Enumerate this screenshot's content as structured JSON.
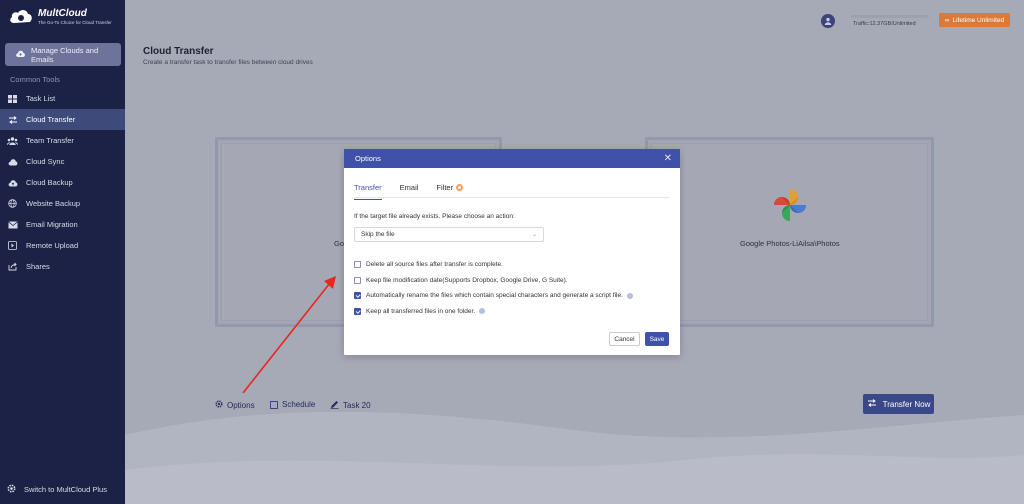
{
  "sidebar": {
    "logo_title": "MultCloud",
    "logo_subtitle": "The Go-To Choice for Cloud Transfer",
    "manage_label": "Manage Clouds and Emails",
    "common_tools_label": "Common Tools",
    "items": [
      {
        "label": "Task List",
        "icon": "task-list-icon"
      },
      {
        "label": "Cloud Transfer",
        "icon": "transfer-icon",
        "active": true
      },
      {
        "label": "Team Transfer",
        "icon": "team-icon"
      },
      {
        "label": "Cloud Sync",
        "icon": "sync-icon"
      },
      {
        "label": "Cloud Backup",
        "icon": "cloud-backup-icon"
      },
      {
        "label": "Website Backup",
        "icon": "globe-icon"
      },
      {
        "label": "Email Migration",
        "icon": "email-icon"
      },
      {
        "label": "Remote Upload",
        "icon": "upload-icon"
      },
      {
        "label": "Shares",
        "icon": "share-icon"
      }
    ],
    "switch_label": "Switch to MultCloud Plus"
  },
  "header": {
    "traffic": "Traffic:12.37GB/Unlimited",
    "lifetime_label": "Lifetime Unlimited"
  },
  "page": {
    "title": "Cloud Transfer",
    "subtitle": "Create a transfer task to transfer files between cloud drives"
  },
  "cards": {
    "left_label": "Go",
    "right_label": "Google Photos-LiAilsa\\Photos"
  },
  "bottom": {
    "options_label": "Options",
    "schedule_label": "Schedule",
    "task_label": "Task 20",
    "transfer_now_label": "Transfer Now"
  },
  "modal": {
    "title": "Options",
    "tabs": [
      {
        "label": "Transfer",
        "active": true
      },
      {
        "label": "Email"
      },
      {
        "label": "Filter"
      }
    ],
    "target_label": "If the target file already exists. Please choose an action:",
    "select_value": "Skip the file",
    "options": [
      {
        "label": "Delete all source files after transfer is complete.",
        "checked": false,
        "info": false
      },
      {
        "label": "Keep file modification date(Supports Dropbox, Google Drive, G Suite).",
        "checked": false,
        "info": false
      },
      {
        "label": "Automatically rename the files which contain special characters and generate a script file.",
        "checked": true,
        "info": true
      },
      {
        "label": "Keep all transferred files in one folder.",
        "checked": true,
        "info": true
      }
    ],
    "cancel_label": "Cancel",
    "save_label": "Save"
  },
  "colors": {
    "sidebar_bg": "#1c2245",
    "accent": "#3f51a8",
    "lifetime_btn": "#d97a3a",
    "arrow": "#e8281e"
  }
}
